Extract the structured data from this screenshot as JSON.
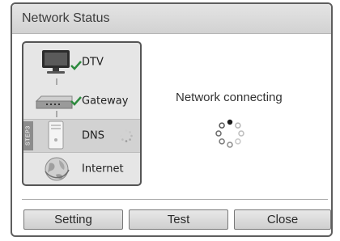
{
  "dialog": {
    "title": "Network Status"
  },
  "steps": [
    {
      "label": "DTV",
      "icon": "tv-icon",
      "status": "connected"
    },
    {
      "label": "Gateway",
      "icon": "router-icon",
      "status": "connected"
    },
    {
      "label": "DNS",
      "icon": "server-icon",
      "status": "in-progress",
      "tag": "STEP3"
    },
    {
      "label": "Internet",
      "icon": "globe-icon",
      "status": "pending"
    }
  ],
  "status": {
    "message": "Network connecting"
  },
  "buttons": {
    "setting": "Setting",
    "test": "Test",
    "close": "Close"
  },
  "colors": {
    "check": "#2d8a3e",
    "panel_border": "#555555"
  }
}
